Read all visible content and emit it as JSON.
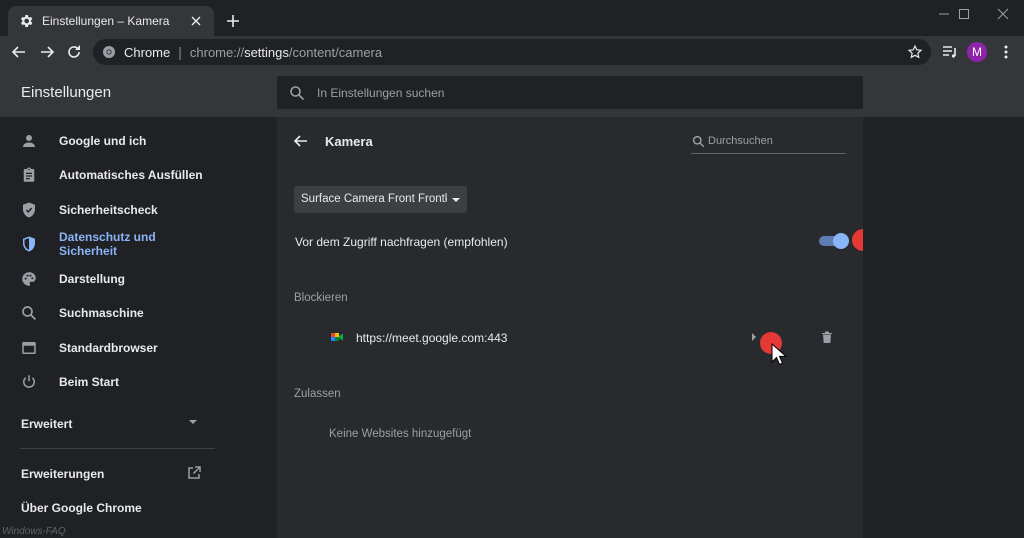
{
  "tab": {
    "title": "Einstellungen – Kamera"
  },
  "omnibox": {
    "site_name": "Chrome",
    "separator": "|",
    "url_prefix": "chrome://",
    "url_host": "settings",
    "url_path": "/content/camera"
  },
  "profile": {
    "initial": "M",
    "color": "#8e24aa"
  },
  "header": {
    "title": "Einstellungen",
    "search_placeholder": "In Einstellungen suchen"
  },
  "sidebar": {
    "items": [
      {
        "label": "Google und ich",
        "icon": "person-icon"
      },
      {
        "label": "Automatisches Ausfüllen",
        "icon": "clipboard-icon"
      },
      {
        "label": "Sicherheitscheck",
        "icon": "shield-check-icon"
      },
      {
        "label": "Datenschutz und Sicherheit",
        "icon": "shield-icon",
        "active": true
      },
      {
        "label": "Darstellung",
        "icon": "palette-icon"
      },
      {
        "label": "Suchmaschine",
        "icon": "search-icon"
      },
      {
        "label": "Standardbrowser",
        "icon": "browser-icon"
      },
      {
        "label": "Beim Start",
        "icon": "power-icon"
      }
    ],
    "advanced": "Erweitert",
    "extensions": "Erweiterungen",
    "about": "Über Google Chrome"
  },
  "camera": {
    "title": "Kamera",
    "search_placeholder": "Durchsuchen",
    "selected_device": "Surface Camera Front Frontkamera",
    "ask_label": "Vor dem Zugriff nachfragen (empfohlen)",
    "ask_enabled": true,
    "block_heading": "Blockieren",
    "blocked_sites": [
      {
        "url": "https://meet.google.com:443"
      }
    ],
    "allow_heading": "Zulassen",
    "allow_empty": "Keine Websites hinzugefügt"
  },
  "watermark": "Windows-FAQ",
  "colors": {
    "accent": "#8ab4f8",
    "background": "#202124",
    "card": "#292a2d",
    "highlight": "#e53935"
  }
}
